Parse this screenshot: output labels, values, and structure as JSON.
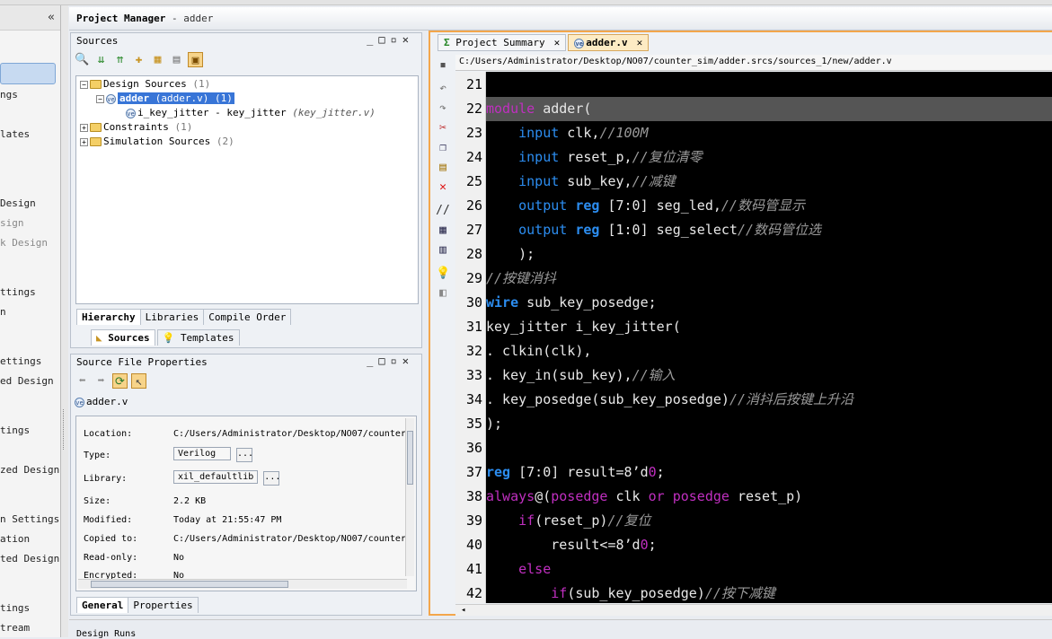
{
  "left_nav": {
    "items": [
      "ngs",
      "lates",
      "Design",
      "sign",
      "k Design",
      "ttings",
      "n",
      "ettings",
      "ed Design",
      "tings",
      "zed Design",
      "n Settings",
      "ation",
      "ted Design",
      "tings",
      "tream"
    ],
    "collapse_icon": "«"
  },
  "project_manager": {
    "title": "Project Manager",
    "subtitle": "- adder"
  },
  "sources": {
    "title": "Sources",
    "tree": {
      "design_sources": "Design Sources",
      "design_sources_count": "(1)",
      "top_module": "adder",
      "top_module_file": "(adder.v)",
      "top_module_count": "(1)",
      "child": "i_key_jitter - key_jitter",
      "child_file": "(key_jitter.v)",
      "constraints": "Constraints",
      "constraints_count": "(1)",
      "sim_sources": "Simulation Sources",
      "sim_sources_count": "(2)"
    },
    "tabs": [
      "Hierarchy",
      "Libraries",
      "Compile Order"
    ],
    "bottom_tabs": [
      "Sources",
      "Templates"
    ]
  },
  "file_props": {
    "title": "Source File Properties",
    "file_name": "adder.v",
    "rows": [
      {
        "label": "Location:",
        "value": "C:/Users/Administrator/Desktop/NO07/counter"
      },
      {
        "label": "Type:",
        "value": "Verilog"
      },
      {
        "label": "Library:",
        "value": "xil_defaultlib"
      },
      {
        "label": "Size:",
        "value": "2.2 KB"
      },
      {
        "label": "Modified:",
        "value": "Today at 21:55:47 PM"
      },
      {
        "label": "Copied to:",
        "value": "C:/Users/Administrator/Desktop/NO07/counter"
      },
      {
        "label": "Read-only:",
        "value": "No"
      },
      {
        "label": "Encrypted:",
        "value": "No"
      }
    ],
    "dots": "...",
    "tabs": [
      "General",
      "Properties"
    ]
  },
  "editor": {
    "tabs": [
      {
        "label": "Project Summary",
        "icon": "Σ"
      },
      {
        "label": "adder.v",
        "icon": "ve"
      }
    ],
    "close": "✕",
    "path": "C:/Users/Administrator/Desktop/NO07/counter_sim/adder.srcs/sources_1/new/adder.v",
    "line_numbers": [
      "21",
      "22",
      "23",
      "24",
      "25",
      "26",
      "27",
      "28",
      "29",
      "30",
      "31",
      "32",
      "33",
      "34",
      "35",
      "36",
      "37",
      "38",
      "39",
      "40",
      "41",
      "42"
    ],
    "lines": [
      [],
      [
        {
          "c": "mod",
          "t": "module"
        },
        {
          "c": "pl",
          "t": " adder("
        }
      ],
      [
        {
          "c": "pl",
          "t": "    "
        },
        {
          "c": "kw",
          "t": "input"
        },
        {
          "c": "pl",
          "t": " clk,"
        },
        {
          "c": "cm",
          "t": "//100M"
        }
      ],
      [
        {
          "c": "pl",
          "t": "    "
        },
        {
          "c": "kw",
          "t": "input"
        },
        {
          "c": "pl",
          "t": " reset_p,"
        },
        {
          "c": "cm",
          "t": "//复位清零"
        }
      ],
      [
        {
          "c": "pl",
          "t": "    "
        },
        {
          "c": "kw",
          "t": "input"
        },
        {
          "c": "pl",
          "t": " sub_key,"
        },
        {
          "c": "cm",
          "t": "//减键"
        }
      ],
      [
        {
          "c": "pl",
          "t": "    "
        },
        {
          "c": "kw",
          "t": "output"
        },
        {
          "c": "pl",
          "t": " "
        },
        {
          "c": "kwb",
          "t": "reg"
        },
        {
          "c": "pl",
          "t": " [7:0] seg_led,"
        },
        {
          "c": "cm",
          "t": "//数码管显示"
        }
      ],
      [
        {
          "c": "pl",
          "t": "    "
        },
        {
          "c": "kw",
          "t": "output"
        },
        {
          "c": "pl",
          "t": " "
        },
        {
          "c": "kwb",
          "t": "reg"
        },
        {
          "c": "pl",
          "t": " [1:0] seg_select"
        },
        {
          "c": "cm",
          "t": "//数码管位选"
        }
      ],
      [
        {
          "c": "pl",
          "t": "    );"
        }
      ],
      [
        {
          "c": "cm",
          "t": "//按键消抖"
        }
      ],
      [
        {
          "c": "kwb",
          "t": "wire"
        },
        {
          "c": "pl",
          "t": " sub_key_posedge;"
        }
      ],
      [
        {
          "c": "pl",
          "t": "key_jitter i_key_jitter("
        }
      ],
      [
        {
          "c": "pl",
          "t": ". clkin(clk),"
        }
      ],
      [
        {
          "c": "pl",
          "t": ". key_in(sub_key),"
        },
        {
          "c": "cm",
          "t": "//输入"
        }
      ],
      [
        {
          "c": "pl",
          "t": ". key_posedge(sub_key_posedge)"
        },
        {
          "c": "cm",
          "t": "//消抖后按键上升沿"
        }
      ],
      [
        {
          "c": "pl",
          "t": ");"
        }
      ],
      [],
      [
        {
          "c": "kwb",
          "t": "reg"
        },
        {
          "c": "pl",
          "t": " [7:0] result=8’d"
        },
        {
          "c": "num",
          "t": "0"
        },
        {
          "c": "pl",
          "t": ";"
        }
      ],
      [
        {
          "c": "mod",
          "t": "always"
        },
        {
          "c": "pl",
          "t": "@("
        },
        {
          "c": "mod",
          "t": "posedge"
        },
        {
          "c": "pl",
          "t": " clk "
        },
        {
          "c": "mod",
          "t": "or"
        },
        {
          "c": "pl",
          "t": " "
        },
        {
          "c": "mod",
          "t": "posedge"
        },
        {
          "c": "pl",
          "t": " reset_p)"
        }
      ],
      [
        {
          "c": "pl",
          "t": "    "
        },
        {
          "c": "mod",
          "t": "if"
        },
        {
          "c": "pl",
          "t": "(reset_p)"
        },
        {
          "c": "cm",
          "t": "//复位"
        }
      ],
      [
        {
          "c": "pl",
          "t": "        result<=8’d"
        },
        {
          "c": "num",
          "t": "0"
        },
        {
          "c": "pl",
          "t": ";"
        }
      ],
      [
        {
          "c": "pl",
          "t": "    "
        },
        {
          "c": "mod",
          "t": "else"
        }
      ],
      [
        {
          "c": "pl",
          "t": "        "
        },
        {
          "c": "mod",
          "t": "if"
        },
        {
          "c": "pl",
          "t": "(sub_key_posedge)"
        },
        {
          "c": "cm",
          "t": "//按下减键"
        }
      ]
    ],
    "current_line_index": 1
  },
  "bottom": {
    "label": "Design Runs"
  },
  "colors": {
    "accent_border": "#f3a64b",
    "code_bg": "#000000",
    "keyword": "#2c8df0",
    "module_kw": "#c02fc0",
    "comment": "#9a9a9a"
  }
}
